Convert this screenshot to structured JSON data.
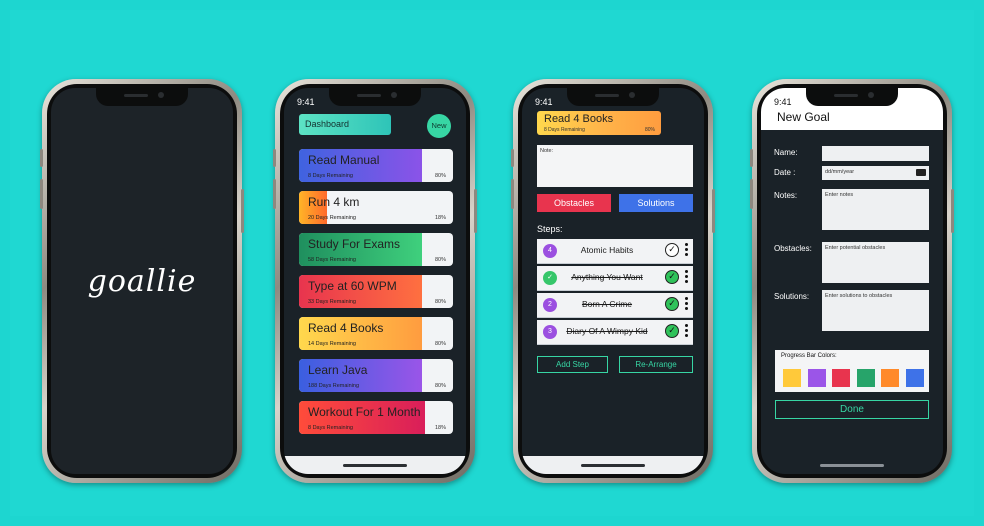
{
  "status_time": "9:41",
  "splash": {
    "logo": "goallie"
  },
  "dashboard": {
    "title": "Dashboard",
    "new_button": "New",
    "goals": [
      {
        "title": "Read  Manual",
        "days": "8 Days Remaining",
        "pct": "80%",
        "progress": 0.8,
        "color_from": "#3f63e0",
        "color_to": "#8b53e8"
      },
      {
        "title": "Run 4 km",
        "days": "20 Days Remaining",
        "pct": "18%",
        "progress": 0.18,
        "color_from": "#ffb427",
        "color_to": "#ff6a2b"
      },
      {
        "title": "Study For Exams",
        "days": "58 Days Remaining",
        "pct": "80%",
        "progress": 0.8,
        "color_from": "#1f8f5e",
        "color_to": "#3fd07d"
      },
      {
        "title": "Type at 60 WPM",
        "days": "33 Days Remaining",
        "pct": "80%",
        "progress": 0.8,
        "color_from": "#e8344e",
        "color_to": "#ff7040"
      },
      {
        "title": "Read 4 Books",
        "days": "14 Days Remaining",
        "pct": "80%",
        "progress": 0.8,
        "color_from": "#ffd84d",
        "color_to": "#ff9c3f"
      },
      {
        "title": "Learn Java",
        "days": "188 Days Remaining",
        "pct": "80%",
        "progress": 0.8,
        "color_from": "#3a5fe0",
        "color_to": "#9a55e8"
      },
      {
        "title": "Workout For 1 Month",
        "days": "8 Days Remaining",
        "pct": "18%",
        "progress": 0.82,
        "color_from": "#ff4c3a",
        "color_to": "#d91e5a"
      }
    ]
  },
  "detail": {
    "title": "Read 4 Books",
    "days": "8 Days Remaining",
    "pct": "80%",
    "note_label": "Note:",
    "obstacles_label": "Obstacles",
    "solutions_label": "Solutions",
    "steps_label": "Steps:",
    "steps": [
      {
        "badge": "4",
        "text": "Atomic Habits",
        "done": false
      },
      {
        "badge": "✓",
        "text": "Anything You Want",
        "done": true
      },
      {
        "badge": "2",
        "text": "Born A Crime",
        "done": true
      },
      {
        "badge": "3",
        "text": "Diary Of A Wimpy Kid",
        "done": true
      }
    ],
    "add_step_label": "Add Step",
    "rearrange_label": "Re-Arrange"
  },
  "new_goal": {
    "title": "New Goal",
    "name_label": "Name:",
    "date_label": "Date :",
    "date_placeholder": "dd/mm/year",
    "notes_label": "Notes:",
    "notes_placeholder": "Enter notes",
    "obstacles_label": "Obstacles:",
    "obstacles_placeholder": "Enter potential obstacles",
    "solutions_label": "Solutions:",
    "solutions_placeholder": "Enter solutions to obstacles",
    "colors_label": "Progress Bar Colors:",
    "colors": [
      "#ffc93a",
      "#9b55e8",
      "#e8344e",
      "#27a46a",
      "#ff8a2a",
      "#3e72e8"
    ],
    "done_label": "Done"
  }
}
